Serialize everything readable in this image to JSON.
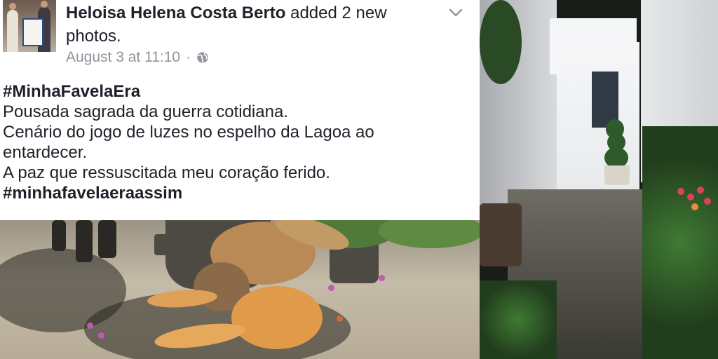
{
  "post": {
    "author": "Heloisa Helena Costa Berto",
    "action": "added 2 new photos.",
    "timestamp": "August 3 at 11:10",
    "separator": "·",
    "audience_icon": "globe-icon",
    "menu_icon": "chevron-down-icon",
    "lines": [
      {
        "text": "#MinhaFavelaEra",
        "hashtag": true
      },
      {
        "text": "Pousada sagrada da guerra cotidiana.",
        "hashtag": false
      },
      {
        "text": "Cenário do jogo de luzes no espelho da Lagoa ao",
        "hashtag": false
      },
      {
        "text": "entardecer.",
        "hashtag": false
      },
      {
        "text": "A paz que ressuscitada meu coração ferido.",
        "hashtag": false
      },
      {
        "text": "#minhafavelaeraassim",
        "hashtag": true
      }
    ]
  },
  "colors": {
    "text": "#1d2129",
    "meta": "#90949c",
    "background": "#ffffff"
  }
}
